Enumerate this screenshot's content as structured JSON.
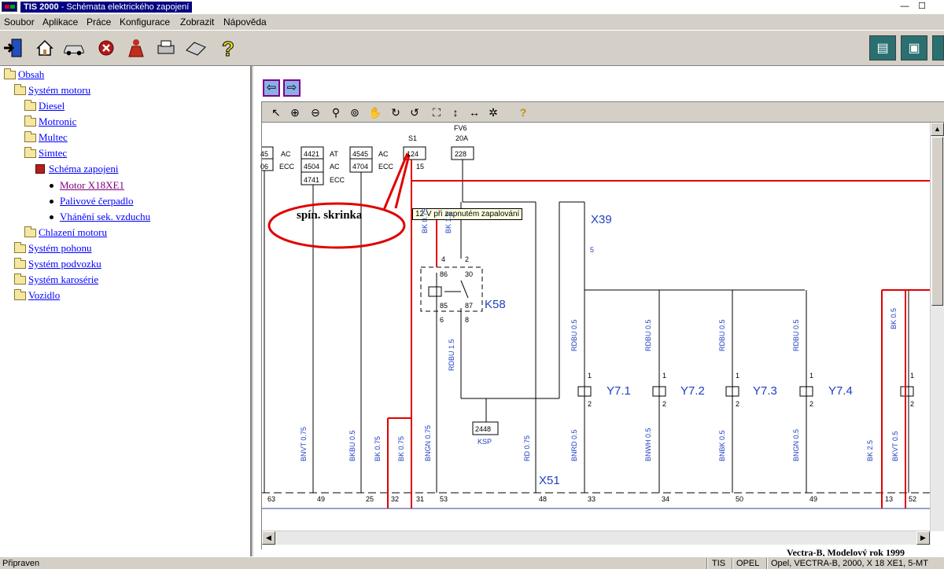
{
  "titlebar": {
    "app": "TIS 2000",
    "title": " - Schémata elektrického zapojení",
    "minimize": "—",
    "maximize": "☐"
  },
  "menu": {
    "items": [
      "Soubor",
      "Aplikace",
      "Práce",
      "Konfigurace",
      "Zobrazit",
      "Nápověda"
    ]
  },
  "toolbar": {
    "icons": [
      "exit-icon",
      "home-icon",
      "vehicle-icon",
      "stop-icon",
      "user-icon",
      "print-icon",
      "keyboard-icon",
      "help-icon"
    ],
    "right_icons": [
      "diagnostics-icon",
      "vehicle-data-icon",
      "remote-icon"
    ]
  },
  "tree": {
    "items": [
      {
        "label": "Obsah",
        "level": 0,
        "icon": "folder"
      },
      {
        "label": "Systém motoru",
        "level": 1,
        "icon": "folder"
      },
      {
        "label": "Diesel",
        "level": 2,
        "icon": "folder"
      },
      {
        "label": "Motronic",
        "level": 2,
        "icon": "folder"
      },
      {
        "label": "Multec",
        "level": 2,
        "icon": "folder"
      },
      {
        "label": "Simtec",
        "level": 2,
        "icon": "folder"
      },
      {
        "label": "Schéma zapojeni",
        "level": 3,
        "icon": "book"
      },
      {
        "label": "Motor X18XE1",
        "level": 4,
        "icon": "bullet",
        "selected": true
      },
      {
        "label": "Palivové čerpadlo",
        "level": 4,
        "icon": "bullet"
      },
      {
        "label": "Vhánění sek. vzduchu",
        "level": 4,
        "icon": "bullet"
      },
      {
        "label": "Chlazení motoru",
        "level": 2,
        "icon": "folder"
      },
      {
        "label": "Systém pohonu",
        "level": 1,
        "icon": "folder"
      },
      {
        "label": "Systém podvozku",
        "level": 1,
        "icon": "folder"
      },
      {
        "label": "Systém karosérie",
        "level": 1,
        "icon": "folder"
      },
      {
        "label": "Vozidlo",
        "level": 1,
        "icon": "folder"
      }
    ]
  },
  "nav": {
    "back": "⇦",
    "forward": "⇨"
  },
  "viewer_toolbar": [
    "pointer-icon",
    "zoom-in-icon",
    "zoom-out-icon",
    "zoom-icon",
    "zoom-area-icon",
    "pan-icon",
    "rotate-cw-icon",
    "rotate-ccw-icon",
    "fit-icon",
    "fit-height-icon",
    "fit-width-icon",
    "highlight-icon",
    "help-icon"
  ],
  "diagram": {
    "annotation": "spín. skrinka",
    "tooltip": "12 V při zapnutém zapalování",
    "top_labels": {
      "s1": "S1",
      "fv6": "FV6",
      "fv6_amp": "20A",
      "ac1": "AC",
      "ecc1": "ECC",
      "at": "AT",
      "ac2": "AC",
      "ac3": "AC",
      "ecc2": "ECC",
      "ecc3": "ECC",
      "fifteen": "15"
    },
    "boxes": [
      "45",
      "06",
      "4421",
      "4504",
      "4741",
      "4545",
      "4704",
      "124",
      "228",
      "2448"
    ],
    "components": {
      "k58": "K58",
      "x39": "X39",
      "x39pin": "5",
      "x51": "X51",
      "ksp": "KSP",
      "y71": "Y7.1",
      "y72": "Y7.2",
      "y73": "Y7.3",
      "y74": "Y7.4"
    },
    "relay_pins": [
      "4",
      "2",
      "86",
      "30",
      "85",
      "87",
      "6",
      "8"
    ],
    "valve_pins": [
      "1",
      "2"
    ],
    "wire_labels": [
      "BK 0.75",
      "BK 1.5",
      "RDBU 1.5",
      "RDBU 0.5",
      "RDBU 0.5",
      "RDBU 0.5",
      "RDBU 0.5",
      "BK 0.5",
      "BNVT 0.75",
      "BKBU 0.5",
      "BK 0.75",
      "BK 0.75",
      "BNGN 0.75",
      "RD 0.75",
      "BNRD 0.5",
      "BNWH 0.5",
      "BNBK 0.5",
      "BNGN 0.5",
      "BK 2.5",
      "BKVT 0.5"
    ],
    "bottom_pins": [
      "63",
      "49",
      "25",
      "32",
      "31",
      "53",
      "48",
      "33",
      "34",
      "50",
      "49",
      "13",
      "52"
    ]
  },
  "footer": "Vectra-B, Modelový rok 1999",
  "status": {
    "ready": "Připraven",
    "tis": "TIS",
    "make": "OPEL",
    "vehicle": "Opel, VECTRA-B, 2000, X 18 XE1, 5-MT"
  }
}
